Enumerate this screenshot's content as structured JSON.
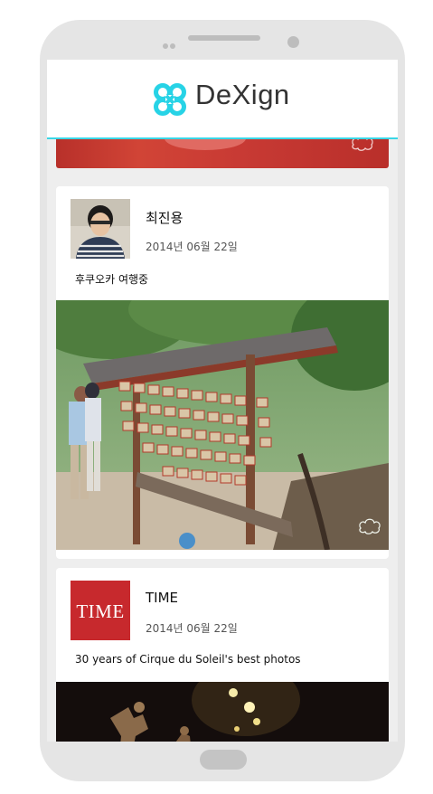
{
  "app": {
    "brand_name": "DeXign",
    "accent_color": "#3ad6e6",
    "logo_icon": "clover-logo-icon"
  },
  "feed": {
    "posts": [
      {
        "author": "최진용",
        "date": "2014년 06월 22일",
        "text": "후쿠오카 여행중",
        "avatar": "user-photo",
        "photo": "shrine-ema-boards-photo"
      },
      {
        "author": "TIME",
        "date": "2014년 06월 22일",
        "text": "30 years of Cirque du Soleil's best photos",
        "avatar_text": "TIME",
        "avatar_color": "#c7292d",
        "photo": "cirque-stage-photo"
      }
    ]
  }
}
